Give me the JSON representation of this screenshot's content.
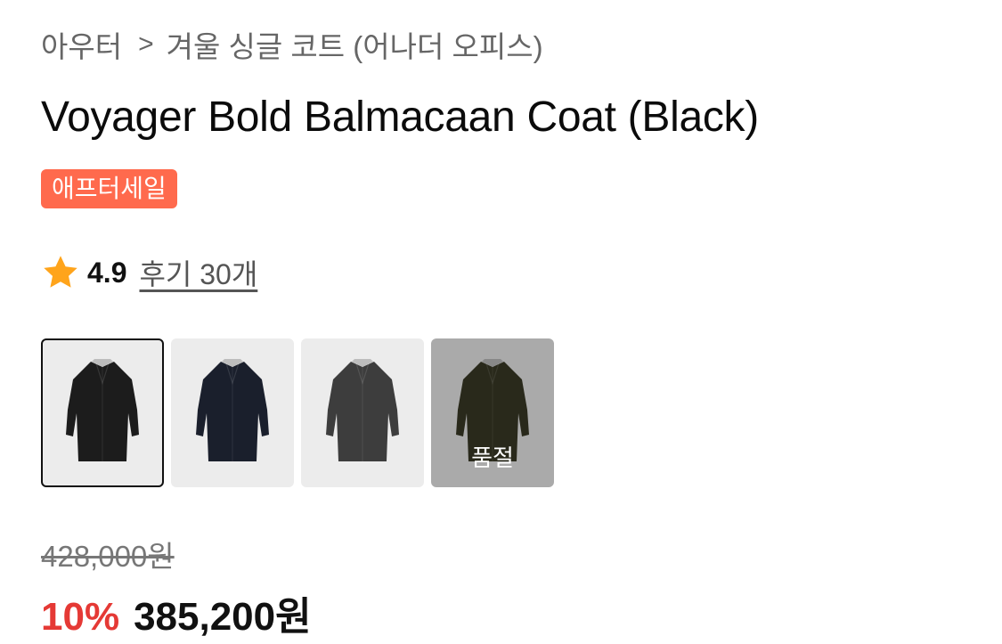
{
  "breadcrumb": {
    "category": "아우터",
    "separator": ">",
    "subcategory": "겨울 싱글 코트 (어나더 오피스)"
  },
  "product": {
    "title": "Voyager Bold Balmacaan Coat (Black)",
    "badge": "애프터세일",
    "rating": "4.9",
    "reviews_label": "후기 30개"
  },
  "colors": {
    "badge": "#ff6a4d",
    "discount": "#e53935",
    "star": "#ffa41b"
  },
  "thumbnails": [
    {
      "name": "black",
      "coat_color": "#1c1c1c",
      "selected": true,
      "sold_out": false
    },
    {
      "name": "navy",
      "coat_color": "#1a1f2c",
      "selected": false,
      "sold_out": false
    },
    {
      "name": "charcoal",
      "coat_color": "#3d3d3d",
      "selected": false,
      "sold_out": false
    },
    {
      "name": "olive",
      "coat_color": "#3a3a26",
      "selected": false,
      "sold_out": true,
      "sold_out_label": "품절"
    }
  ],
  "price": {
    "original": "428,000원",
    "discount": "10%",
    "sale": "385,200원"
  }
}
